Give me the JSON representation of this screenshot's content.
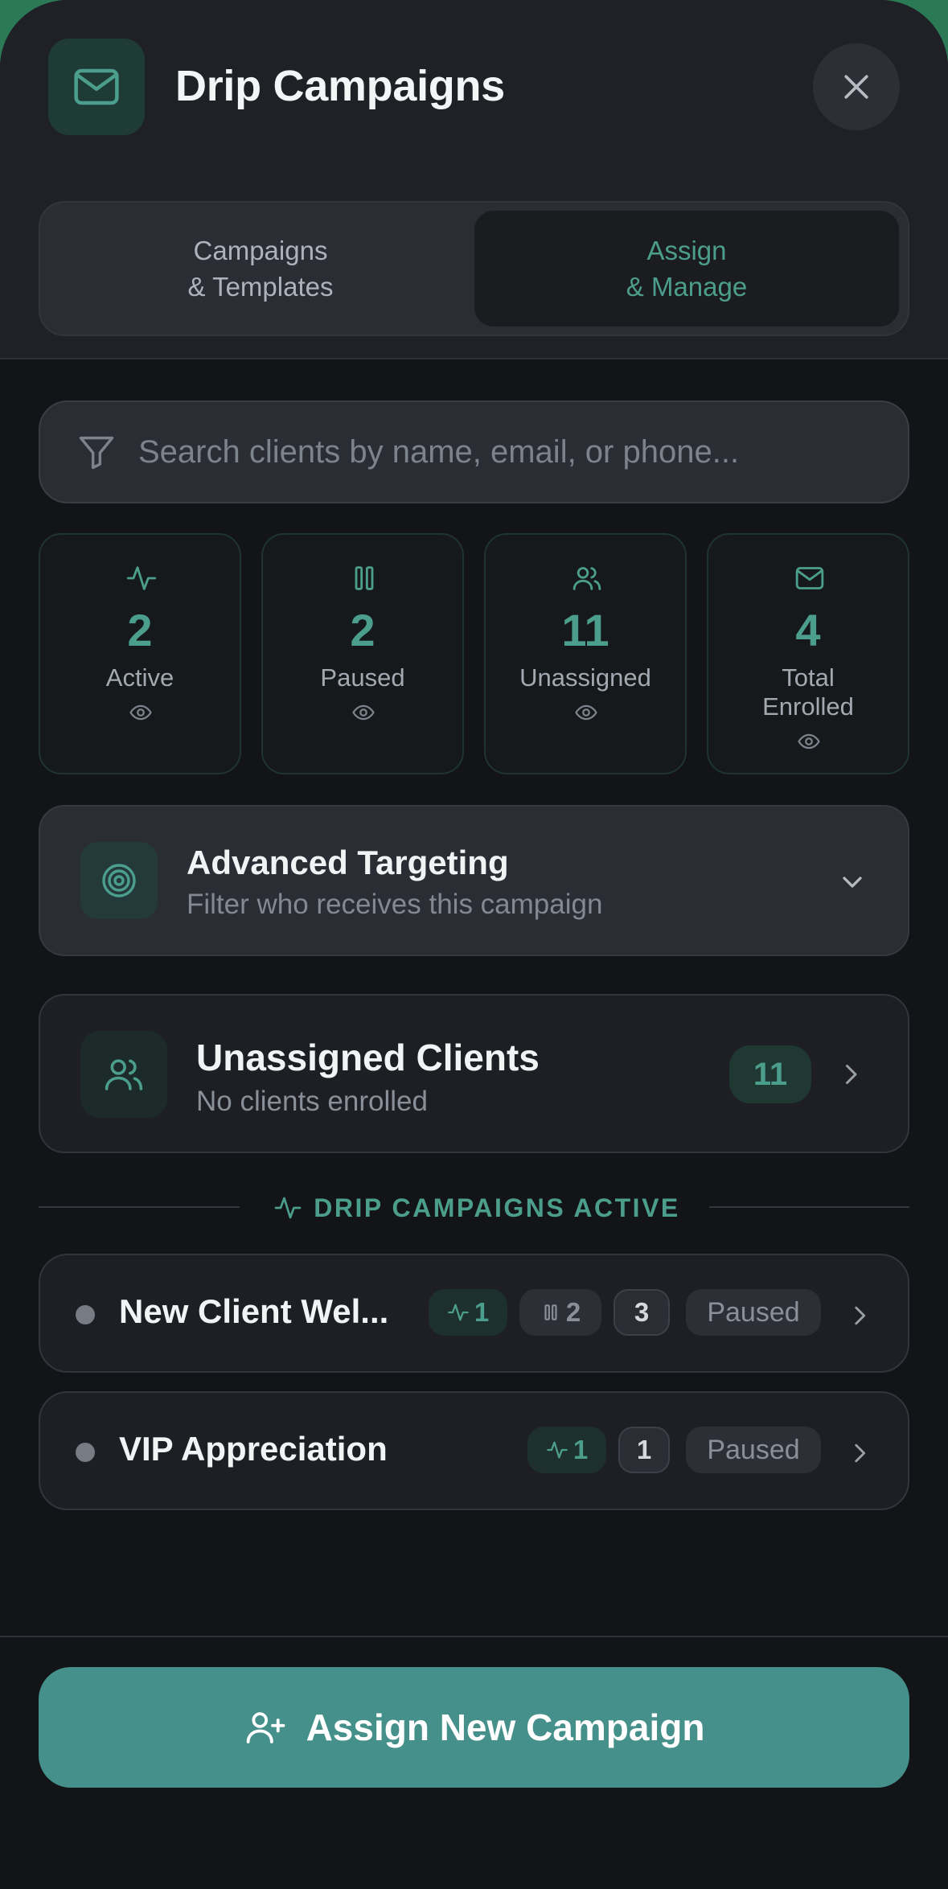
{
  "header": {
    "title": "Drip Campaigns",
    "icon": "mail-icon",
    "close_icon": "close-icon"
  },
  "tabs": [
    {
      "label": "Campaigns\n& Templates",
      "selected": false
    },
    {
      "label": "Assign\n& Manage",
      "selected": true
    }
  ],
  "search": {
    "placeholder": "Search clients by name, email, or phone...",
    "value": "",
    "icon": "filter-icon"
  },
  "stats": [
    {
      "value": "2",
      "label": "Active",
      "icon": "activity-icon"
    },
    {
      "value": "2",
      "label": "Paused",
      "icon": "pause-icon"
    },
    {
      "value": "11",
      "label": "Unassigned",
      "icon": "users-icon"
    },
    {
      "value": "4",
      "label": "Total\nEnrolled",
      "icon": "mail-icon"
    }
  ],
  "targeting": {
    "title": "Advanced Targeting",
    "subtitle": "Filter who receives this campaign",
    "icon": "target-icon"
  },
  "unassigned": {
    "title": "Unassigned Clients",
    "subtitle": "No clients enrolled",
    "count": "11",
    "icon": "users-icon"
  },
  "section": {
    "label": "DRIP CAMPAIGNS ACTIVE",
    "icon": "activity-icon"
  },
  "campaigns": [
    {
      "name": "New Client Wel...",
      "active": "1",
      "paused": "2",
      "total": "3",
      "status": "Paused"
    },
    {
      "name": "VIP Appreciation",
      "active": "1",
      "paused": null,
      "total": "1",
      "status": "Paused"
    }
  ],
  "cta": {
    "label": "Assign New Campaign",
    "icon": "user-plus-icon"
  },
  "colors": {
    "accent": "#4c9e8c",
    "cta": "#45908a",
    "background": "#131418",
    "panel": "#2a2d33"
  }
}
